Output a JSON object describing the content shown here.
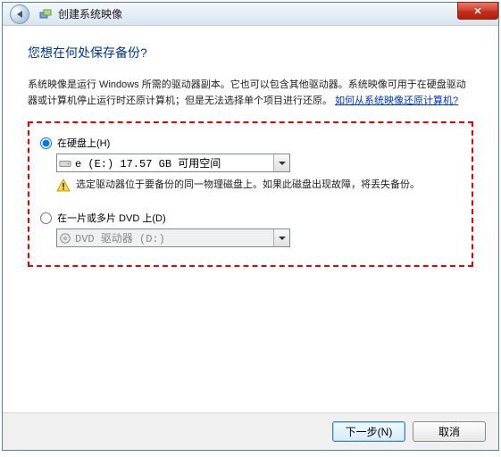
{
  "window": {
    "title": "创建系统映像"
  },
  "heading": "您想在何处保存备份?",
  "description": "系统映像是运行 Windows 所需的驱动器副本。它也可以包含其他驱动器。系统映像可用于在硬盘驱动器或计算机停止运行时还原计算机；但是无法选择单个项目进行还原。",
  "help_link": "如何从系统映像还原计算机?",
  "options": {
    "hard_disk": {
      "label": "在硬盘上(H)",
      "selected_value": "e (E:)  17.57 GB 可用空间",
      "warning": "选定驱动器位于要备份的同一物理磁盘上。如果此磁盘出现故障，将丢失备份。"
    },
    "dvd": {
      "label": "在一片或多片 DVD 上(D)",
      "selected_value": "DVD 驱动器 (D:)"
    }
  },
  "buttons": {
    "next": "下一步(N)",
    "cancel": "取消"
  }
}
